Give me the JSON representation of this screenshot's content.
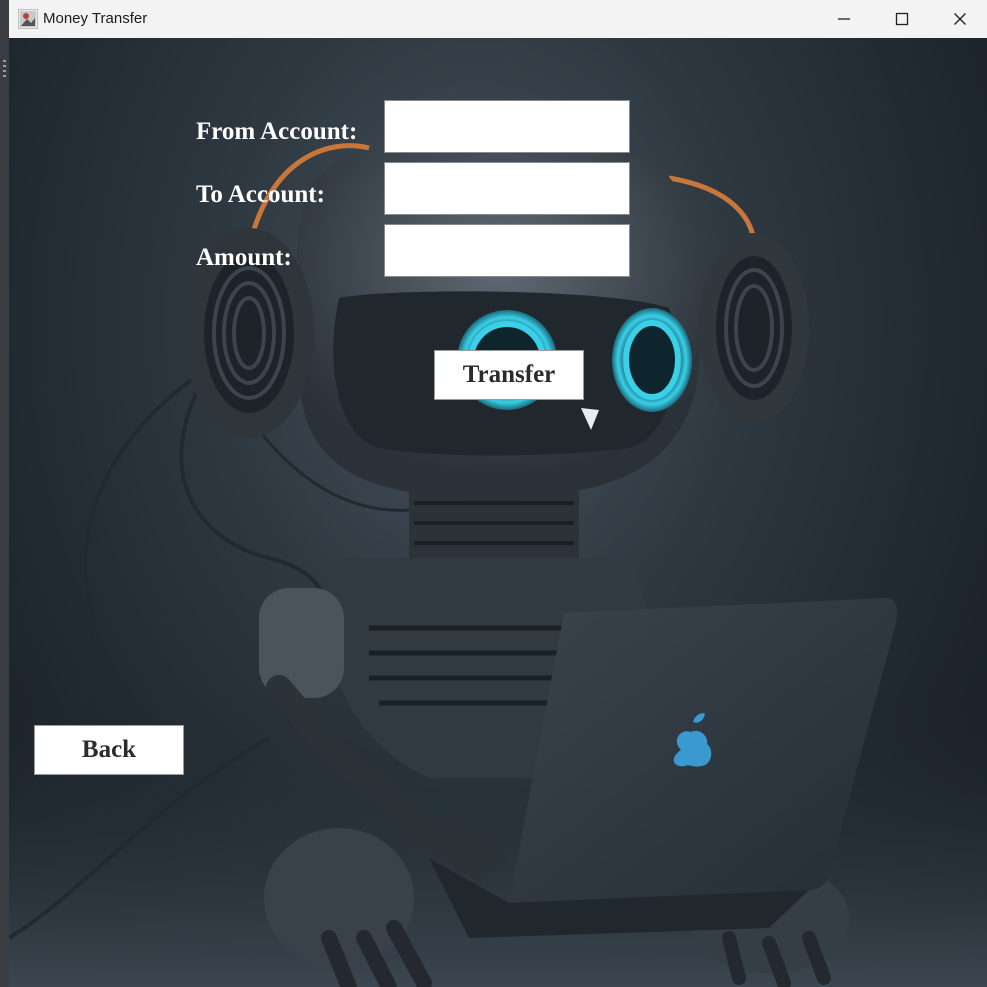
{
  "window": {
    "title": "Money Transfer"
  },
  "form": {
    "from_label": "From Account:",
    "from_value": "",
    "to_label": "To Account:",
    "to_value": "",
    "amount_label": "Amount:",
    "amount_value": "",
    "transfer_label": "Transfer"
  },
  "nav": {
    "back_label": "Back"
  },
  "background": {
    "description_icon": "robot-with-headphones-and-laptop-image",
    "laptop_logo_icon": "apple-logo-icon"
  },
  "colors": {
    "titlebar": "#f3f3f3",
    "eye_glow": "#3ad0e8",
    "cable_accent": "#c8763a",
    "apple_logo": "#3a9ad0"
  }
}
